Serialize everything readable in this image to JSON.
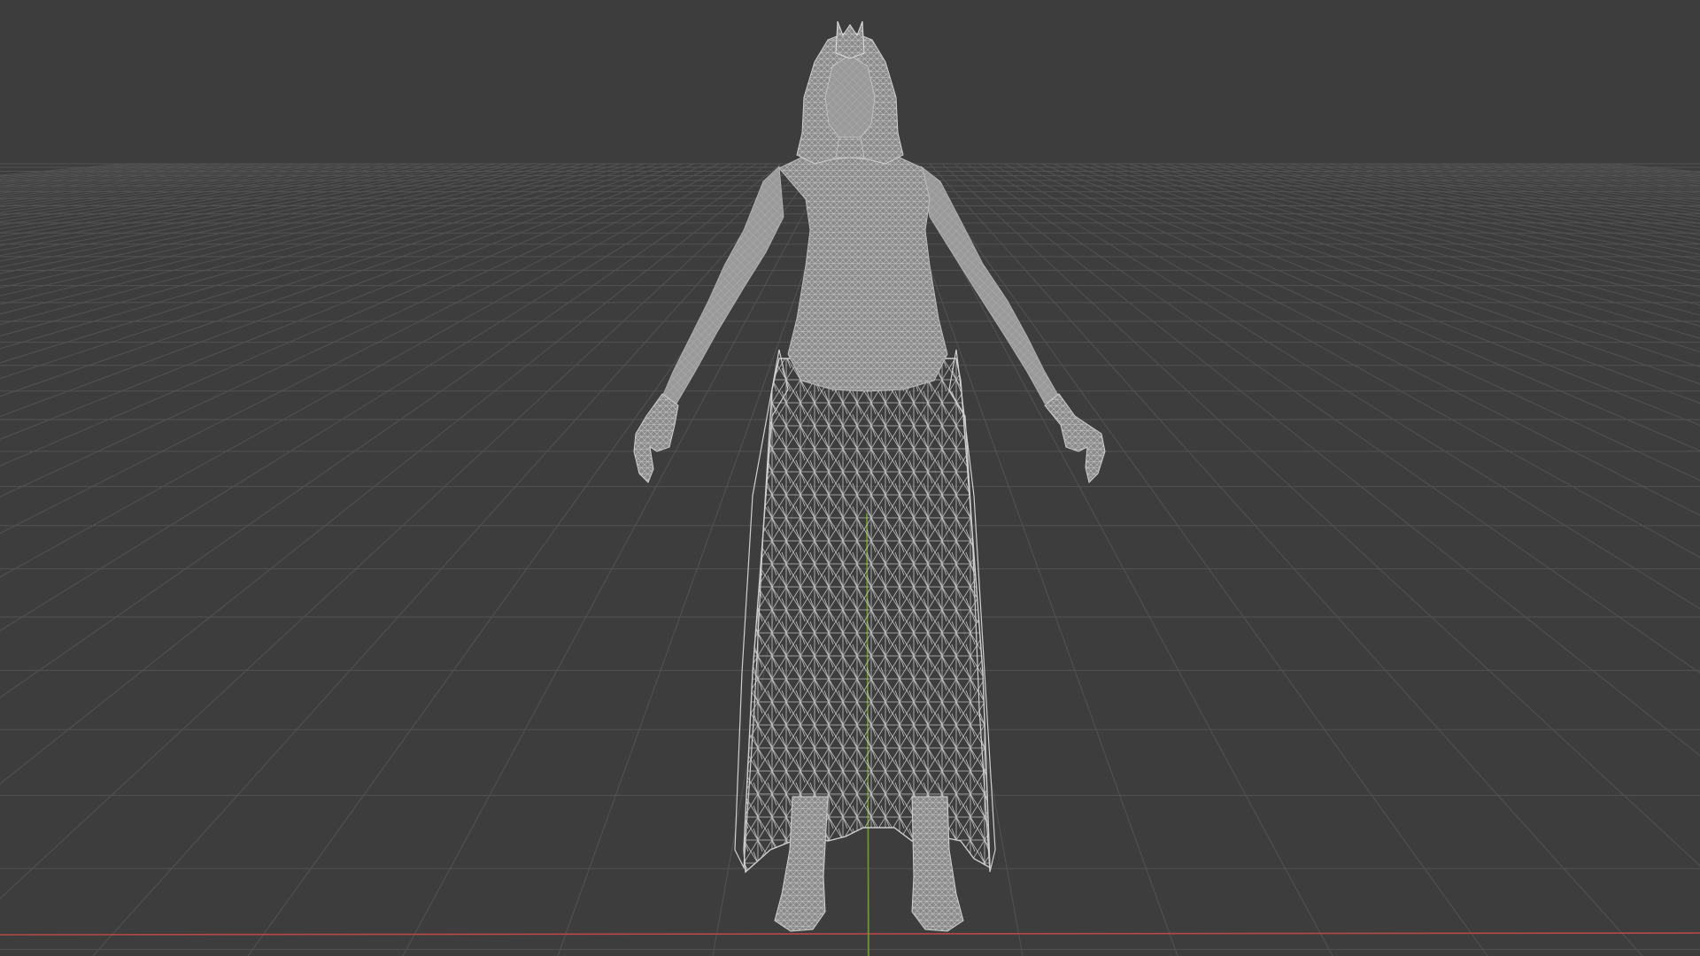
{
  "viewport": {
    "view_mode": "wireframe",
    "background_color": "#3d3d3d",
    "grid": true,
    "grid_line_color": "#525252",
    "x_axis_color": "#b84848",
    "y_axis_color": "#6e9a2a",
    "wireframe_color": "#d8d8d8",
    "mesh_fill_color": "#8a8a8a"
  }
}
